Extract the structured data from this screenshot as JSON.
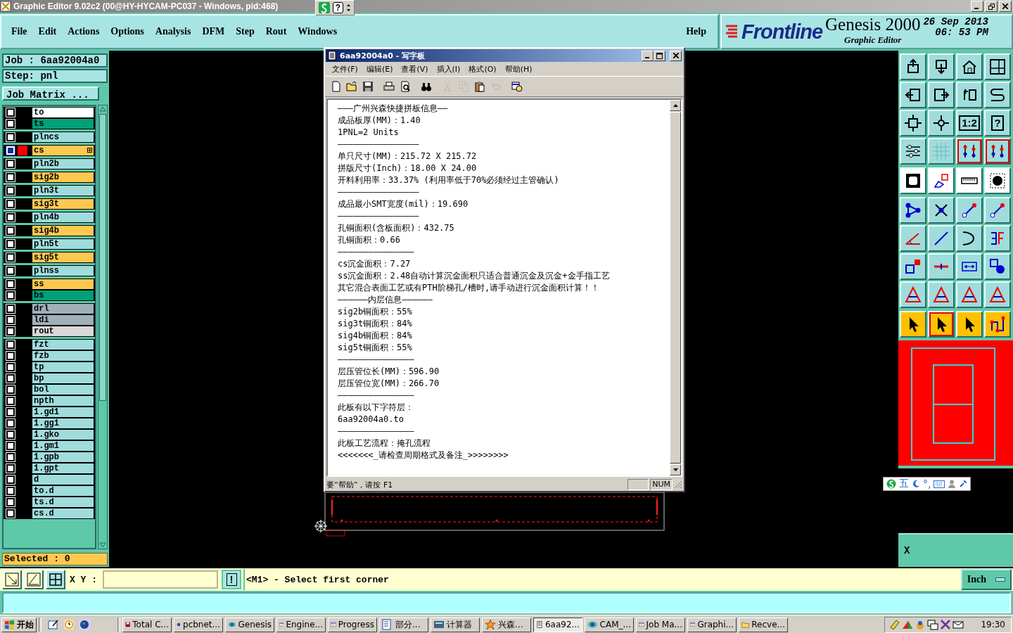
{
  "title_bar": {
    "title": "Graphic Editor 9.02c2 (00@HY-HYCAM-PC037 - Windows, pid:468)",
    "help_key": "?"
  },
  "menu": [
    "File",
    "Edit",
    "Actions",
    "Options",
    "Analysis",
    "DFM",
    "Step",
    "Rout",
    "Windows"
  ],
  "help_menu": "Help",
  "brand": {
    "logo": "Frontline",
    "product": "Genesis 2000",
    "subtitle": "Graphic Editor",
    "date": "26 Sep 2013",
    "time": "06: 53 PM"
  },
  "job": {
    "job": "Job : 6aa92004a0",
    "step": "Step: pnl",
    "matrix_button": "Job Matrix ..."
  },
  "layer_groups": [
    {
      "layers": [
        {
          "name": "to",
          "color": "#ffffff",
          "selected": false,
          "active": false
        },
        {
          "name": "ts",
          "color": "#00a078",
          "selected": false,
          "active": false
        }
      ]
    },
    {
      "layers": [
        {
          "name": "plncs",
          "color": "#a0dcdc",
          "selected": false,
          "active": false
        }
      ]
    },
    {
      "layers": [
        {
          "name": "cs",
          "color": "#ffc850",
          "selected": true,
          "active": true
        }
      ]
    },
    {
      "layers": [
        {
          "name": "pln2b",
          "color": "#a0dcdc",
          "selected": false,
          "active": false
        }
      ]
    },
    {
      "layers": [
        {
          "name": "sig2b",
          "color": "#ffc850",
          "selected": false,
          "active": false
        }
      ]
    },
    {
      "layers": [
        {
          "name": "pln3t",
          "color": "#a0dcdc",
          "selected": false,
          "active": false
        }
      ]
    },
    {
      "layers": [
        {
          "name": "sig3t",
          "color": "#ffc850",
          "selected": false,
          "active": false
        }
      ]
    },
    {
      "layers": [
        {
          "name": "pln4b",
          "color": "#a0dcdc",
          "selected": false,
          "active": false
        }
      ]
    },
    {
      "layers": [
        {
          "name": "sig4b",
          "color": "#ffc850",
          "selected": false,
          "active": false
        }
      ]
    },
    {
      "layers": [
        {
          "name": "pln5t",
          "color": "#a0dcdc",
          "selected": false,
          "active": false
        }
      ]
    },
    {
      "layers": [
        {
          "name": "sig5t",
          "color": "#ffc850",
          "selected": false,
          "active": false
        }
      ]
    },
    {
      "layers": [
        {
          "name": "plnss",
          "color": "#a0dcdc",
          "selected": false,
          "active": false
        }
      ]
    },
    {
      "layers": [
        {
          "name": "ss",
          "color": "#ffc850",
          "selected": false,
          "active": false
        },
        {
          "name": "bs",
          "color": "#00a078",
          "selected": false,
          "active": false
        }
      ]
    },
    {
      "layers": [
        {
          "name": "drl",
          "color": "#a0b0b8",
          "selected": false,
          "active": false
        },
        {
          "name": "ldi",
          "color": "#a0b0b8",
          "selected": false,
          "active": false
        },
        {
          "name": "rout",
          "color": "#d8d8d8",
          "selected": false,
          "active": false
        }
      ]
    },
    {
      "layers": [
        {
          "name": "fzt",
          "color": "#a0dcdc",
          "selected": false,
          "active": false
        },
        {
          "name": "fzb",
          "color": "#a0dcdc",
          "selected": false,
          "active": false
        },
        {
          "name": "tp",
          "color": "#a0dcdc",
          "selected": false,
          "active": false
        },
        {
          "name": "bp",
          "color": "#a0dcdc",
          "selected": false,
          "active": false
        },
        {
          "name": "bol",
          "color": "#a0dcdc",
          "selected": false,
          "active": false
        },
        {
          "name": "npth",
          "color": "#a0dcdc",
          "selected": false,
          "active": false
        },
        {
          "name": "1.gd1",
          "color": "#a0dcdc",
          "selected": false,
          "active": false
        },
        {
          "name": "1.gg1",
          "color": "#a0dcdc",
          "selected": false,
          "active": false
        },
        {
          "name": "1.gko",
          "color": "#a0dcdc",
          "selected": false,
          "active": false
        },
        {
          "name": "1.gm1",
          "color": "#a0dcdc",
          "selected": false,
          "active": false
        },
        {
          "name": "1.gpb",
          "color": "#a0dcdc",
          "selected": false,
          "active": false
        },
        {
          "name": "1.gpt",
          "color": "#a0dcdc",
          "selected": false,
          "active": false
        },
        {
          "name": "d",
          "color": "#a0dcdc",
          "selected": false,
          "active": false
        },
        {
          "name": "to.d",
          "color": "#a0dcdc",
          "selected": false,
          "active": false
        },
        {
          "name": "ts.d",
          "color": "#a0dcdc",
          "selected": false,
          "active": false
        },
        {
          "name": "cs.d",
          "color": "#a0dcdc",
          "selected": false,
          "active": false
        }
      ]
    }
  ],
  "selected_count": "Selected : 0",
  "tool_groups": [
    {
      "tools": [
        {
          "kind": "export",
          "selected": false
        },
        {
          "kind": "import",
          "selected": false
        },
        {
          "kind": "house",
          "selected": false
        },
        {
          "kind": "panes",
          "selected": false
        },
        {
          "kind": "arrow-left",
          "selected": false
        },
        {
          "kind": "arrow-right",
          "selected": false
        },
        {
          "kind": "return",
          "selected": false
        },
        {
          "kind": "s-curve",
          "selected": false
        },
        {
          "kind": "expand",
          "selected": false
        },
        {
          "kind": "move",
          "selected": false
        },
        {
          "kind": "text",
          "label": "1:2",
          "selected": false
        },
        {
          "kind": "text",
          "label": "?",
          "selected": false
        },
        {
          "kind": "sliders",
          "selected": false
        },
        {
          "kind": "grid",
          "selected": false
        },
        {
          "kind": "nodes",
          "selected": true
        },
        {
          "kind": "nodes",
          "selected": true
        }
      ]
    },
    {
      "tools": [
        {
          "kind": "frame",
          "selected": false
        },
        {
          "kind": "pencil",
          "selected": false
        },
        {
          "kind": "ruler",
          "selected": false
        },
        {
          "kind": "dot",
          "selected": false
        }
      ]
    },
    {
      "tools": [
        {
          "kind": "graph",
          "selected": false
        },
        {
          "kind": "cross",
          "selected": false
        },
        {
          "kind": "segment",
          "selected": false
        },
        {
          "kind": "segment",
          "selected": false
        },
        {
          "kind": "angle",
          "selected": false
        },
        {
          "kind": "slash",
          "selected": false
        },
        {
          "kind": "arc",
          "selected": false
        },
        {
          "kind": "mirror",
          "selected": false
        },
        {
          "kind": "square-dot",
          "selected": false
        },
        {
          "kind": "dash",
          "selected": false
        },
        {
          "kind": "measure",
          "selected": false
        },
        {
          "kind": "shapes",
          "selected": false
        },
        {
          "kind": "triangle",
          "selected": false
        },
        {
          "kind": "triangle",
          "selected": false
        },
        {
          "kind": "triangle",
          "selected": false
        },
        {
          "kind": "triangle",
          "selected": false
        }
      ]
    },
    {
      "tools": [
        {
          "kind": "pointer",
          "selected": false
        },
        {
          "kind": "pointer",
          "selected": true
        },
        {
          "kind": "pointer",
          "selected": false
        },
        {
          "kind": "flow",
          "selected": false
        }
      ]
    }
  ],
  "ime": {
    "input_mode": "五",
    "punctuation": "°,"
  },
  "coordinate_panel": {
    "label": "X"
  },
  "command": {
    "xy_label": "X Y :",
    "alert": "!",
    "prompt": "<M1> - Select first corner",
    "units": "Inch"
  },
  "notepad": {
    "title": "6aa92004a0 - 写字板",
    "menu": [
      "文件(F)",
      "编辑(E)",
      "查看(V)",
      "插入(I)",
      "格式(O)",
      "帮助(H)"
    ],
    "toolbar": [
      {
        "kind": "new",
        "disabled": false
      },
      {
        "kind": "open",
        "disabled": false
      },
      {
        "kind": "save",
        "disabled": false
      },
      {
        "kind": "print",
        "disabled": false
      },
      {
        "kind": "preview",
        "disabled": false
      },
      {
        "kind": "find",
        "disabled": false
      },
      {
        "kind": "cut",
        "disabled": true
      },
      {
        "kind": "copy",
        "disabled": true
      },
      {
        "kind": "paste",
        "disabled": false
      },
      {
        "kind": "undo",
        "disabled": true
      },
      {
        "kind": "datetime",
        "disabled": false
      }
    ],
    "lines": [
      "———广州兴森快捷拼板信息——",
      "成品板厚(MM)：1.40",
      "1PNL=2 Units",
      "————————————————",
      "单只尺寸(MM)：215.72 X 215.72",
      "拼版尺寸(Inch)：18.00 X 24.00",
      "开料利用率：33.37% (利用率低于70%必须经过主管确认)",
      "————————————————",
      "成品最小SMT宽度(mil)：19.690",
      "————————————————",
      "孔铜面积(含板面积)：432.75",
      "孔铜面积：0.66",
      "———————————————",
      "cs沉金面积：7.27",
      "ss沉金面积：2.48自动计算沉金面积只适合普通沉金及沉金+金手指工艺",
      "其它混合表面工艺或有PTH阶梯孔/槽时,请手动进行沉金面积计算！！",
      "——————内层信息——————",
      "sig2b铜面积：55%",
      "sig3t铜面积：84%",
      "sig4b铜面积：84%",
      "sig5t铜面积：55%",
      "———————————————",
      "层压管位长(MM)：596.90",
      "层压管位宽(MM)：266.70",
      "———————————————",
      "此板有以下字符层：",
      "6aa92004a0.to",
      "———————————————",
      "此板工艺流程：掩孔流程",
      "<<<<<<<_请检查周期格式及备注_>>>>>>>>"
    ],
    "status": "要“帮助”，请按 F1",
    "num_lock": "NUM"
  },
  "taskbar": {
    "start": "开始",
    "tasks": [
      {
        "label": "Total C...",
        "selected": false
      },
      {
        "label": "pcbnet...",
        "selected": false
      },
      {
        "label": "Genesis",
        "selected": false
      },
      {
        "label": "Engine...",
        "selected": false
      },
      {
        "label": "Progress",
        "selected": false
      },
      {
        "label": "部分...",
        "selected": false
      },
      {
        "label": "计算器",
        "selected": false
      },
      {
        "label": "兴森...",
        "selected": false
      },
      {
        "label": "6aa92...",
        "selected": true
      },
      {
        "label": "CAM_...",
        "selected": false
      },
      {
        "label": "Job Ma...",
        "selected": false
      },
      {
        "label": "Graphi...",
        "selected": false
      },
      {
        "label": "Recve...",
        "selected": false
      }
    ],
    "clock": "19:30"
  }
}
